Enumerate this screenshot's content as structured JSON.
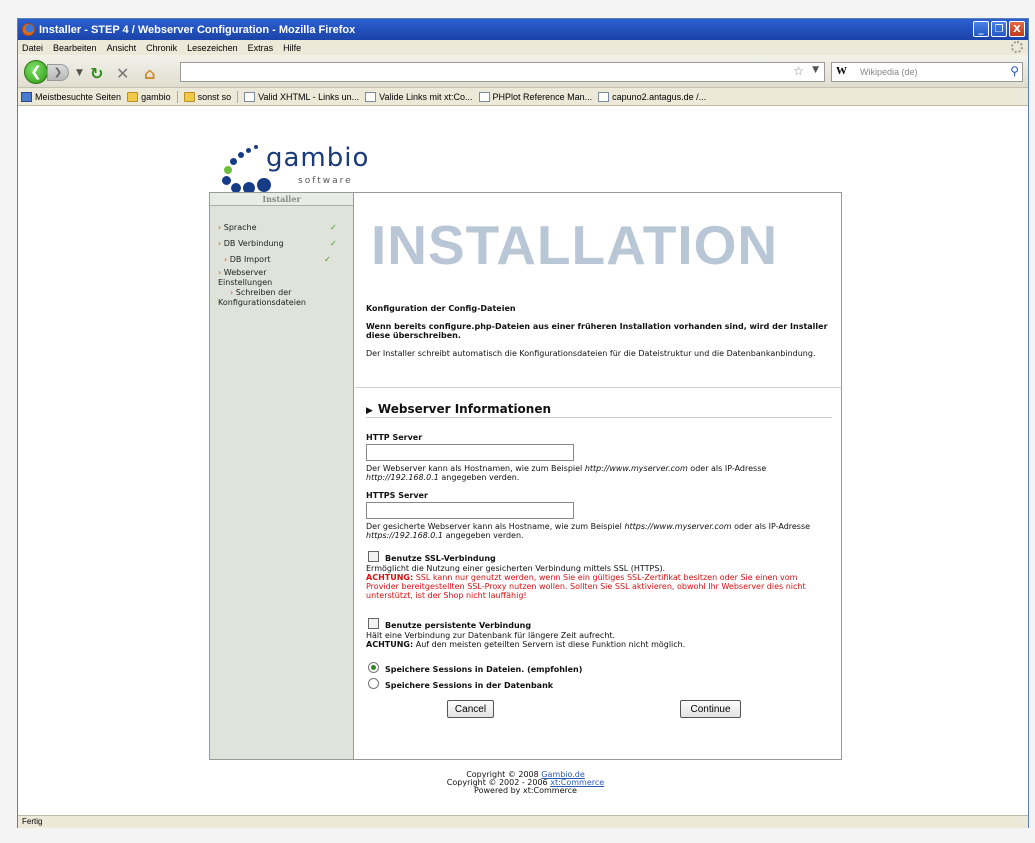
{
  "window": {
    "title": "Installer - STEP 4 / Webserver Configuration - Mozilla Firefox",
    "controls": [
      "_",
      "❐",
      "X"
    ]
  },
  "menu": [
    "Datei",
    "Bearbeiten",
    "Ansicht",
    "Chronik",
    "Lesezeichen",
    "Extras",
    "Hilfe"
  ],
  "nav": {
    "back_icon": "back-arrow-icon",
    "forward_icon": "forward-arrow-icon",
    "reload_icon": "reload-icon",
    "stop_icon": "stop-icon",
    "home_icon": "home-icon",
    "url": "",
    "search_placeholder": "Wikipedia (de)"
  },
  "bookmarks": [
    "Meistbesuchte Seiten",
    "gambio",
    "sonst so",
    "Valid XHTML - Links un...",
    "Valide Links mit xt:Co...",
    "PHPlot Reference Man...",
    "capuno2.antagus.de /..."
  ],
  "status": "Fertig",
  "logo": {
    "word": "gambio",
    "sub": "software"
  },
  "sidebar": {
    "title": "Installer",
    "steps": [
      {
        "label": "Sprache",
        "done": true
      },
      {
        "label": "DB Verbindung",
        "done": true
      },
      {
        "label": "DB Import",
        "done": true
      },
      {
        "label": "Webserver Einstellungen",
        "done": false
      },
      {
        "label": "Schreiben der Konfigurationsdateien",
        "done": false
      }
    ]
  },
  "main": {
    "banner": "INSTALLATION",
    "intro_title": "Konfiguration der Config-Dateien",
    "intro_bold": "Wenn bereits configure.php-Dateien aus einer früheren Installation vorhanden sind, wird der Installer diese überschreiben.",
    "intro_text": "Der Installer schreibt automatisch die Konfigurationsdateien für die Dateistruktur und die Datenbankanbindung.",
    "section_title": "Webserver Informationen",
    "http": {
      "label": "HTTP Server",
      "value": "",
      "help_a": "Der Webserver kann als Hostnamen, wie zum Beispiel",
      "help_ex1": "http://www.myserver.com",
      "help_b": "oder als IP-Adresse",
      "help_ex2": "http://192.168.0.1",
      "help_c": "angegeben verden."
    },
    "https": {
      "label": "HTTPS Server",
      "value": "",
      "help_a": "Der gesicherte Webserver kann als Hostname, wie zum Beispiel",
      "help_ex1": "https://www.myserver.com",
      "help_b": "oder als IP-Adresse",
      "help_ex2": "https://192.168.0.1",
      "help_c": "angegeben verden."
    },
    "ssl": {
      "label": "Benutze SSL-Verbindung",
      "desc": "Ermöglicht die Nutzung einer gesicherten Verbindung mittels SSL (HTTPS).",
      "warn_label": "ACHTUNG:",
      "warn": "SSL kann nur genutzt werden, wenn Sie ein gültiges SSL-Zertifikat besitzen oder Sie einen vom Provider bereitgestellten SSL-Proxy nutzen wollen. Sollten Sie SSL aktivieren, obwohl Ihr Webserver dies nicht unterstützt, ist der Shop nicht lauffähig!",
      "checked": false
    },
    "persistent": {
      "label": "Benutze persistente Verbindung",
      "desc": "Hält eine Verbindung zur Datenbank für längere Zeit aufrecht.",
      "warn_label": "ACHTUNG:",
      "warn": "Auf den meisten geteilten Servern ist diese Funktion nicht möglich.",
      "checked": false
    },
    "sessions": [
      {
        "label": "Speichere Sessions in Dateien. (empfohlen)",
        "selected": true
      },
      {
        "label": "Speichere Sessions in der Datenbank",
        "selected": false
      }
    ],
    "cancel_label": "Cancel",
    "continue_label": "Continue"
  },
  "footer": {
    "line1_prefix": "Copyright © 2008",
    "line1_link": "Gambio.de",
    "line2_prefix": "Copyright © 2002 - 2006",
    "line2_link": "xt:Commerce",
    "line3": "Powered by xt:Commerce"
  }
}
